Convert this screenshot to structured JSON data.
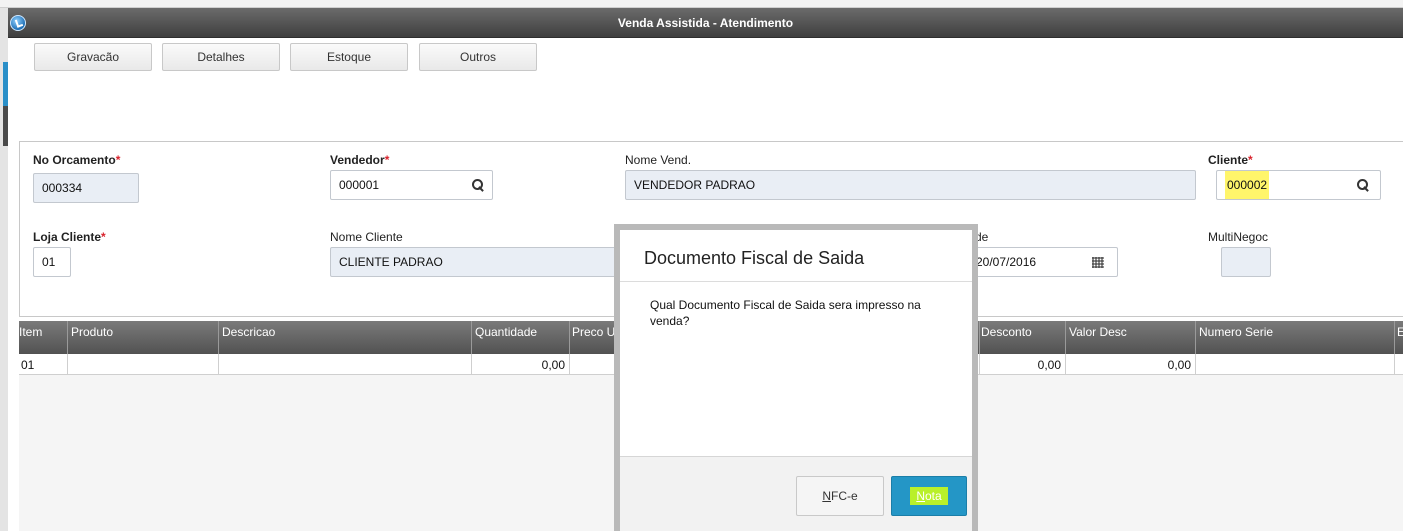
{
  "window": {
    "title": "Venda Assistida - Atendimento"
  },
  "toolbar": {
    "gravacao": "Gravacão",
    "detalhes": "Detalhes",
    "estoque": "Estoque",
    "outros": "Outros"
  },
  "form": {
    "orcamento_label": "No Orcamento",
    "orcamento_value": "000334",
    "vendedor_label": "Vendedor",
    "vendedor_value": "000001",
    "nome_vend_label": "Nome Vend.",
    "nome_vend_value": "VENDEDOR PADRAO",
    "cliente_label": "Cliente",
    "cliente_value": "000002",
    "loja_label": "Loja Cliente",
    "loja_value": "01",
    "nome_cliente_label": "Nome Cliente",
    "nome_cliente_value": "CLIENTE PADRAO",
    "date_label_fragment": "de",
    "date_value": "20/07/2016",
    "multinegoc_label": "MultiNegoc",
    "required_mark": "*"
  },
  "grid": {
    "columns": [
      "Item",
      "Produto",
      "Descricao",
      "Quantidade",
      "Preco U",
      "Desconto",
      "Valor Desc",
      "Numero Serie",
      "E"
    ],
    "rows": [
      {
        "item": "01",
        "quantidade": "0,00",
        "desconto": "0,00",
        "valor_desc": "0,00"
      }
    ]
  },
  "modal": {
    "title": "Documento Fiscal de Saida",
    "message": "Qual Documento Fiscal de Saida sera impresso na venda?",
    "nfce_first": "N",
    "nfce_rest": "FC-e",
    "nota_first": "N",
    "nota_rest": "ota"
  },
  "colors": {
    "accent": "#2496c6",
    "highlight": "#fff56b",
    "required": "#d9232d",
    "header": "#525252"
  }
}
